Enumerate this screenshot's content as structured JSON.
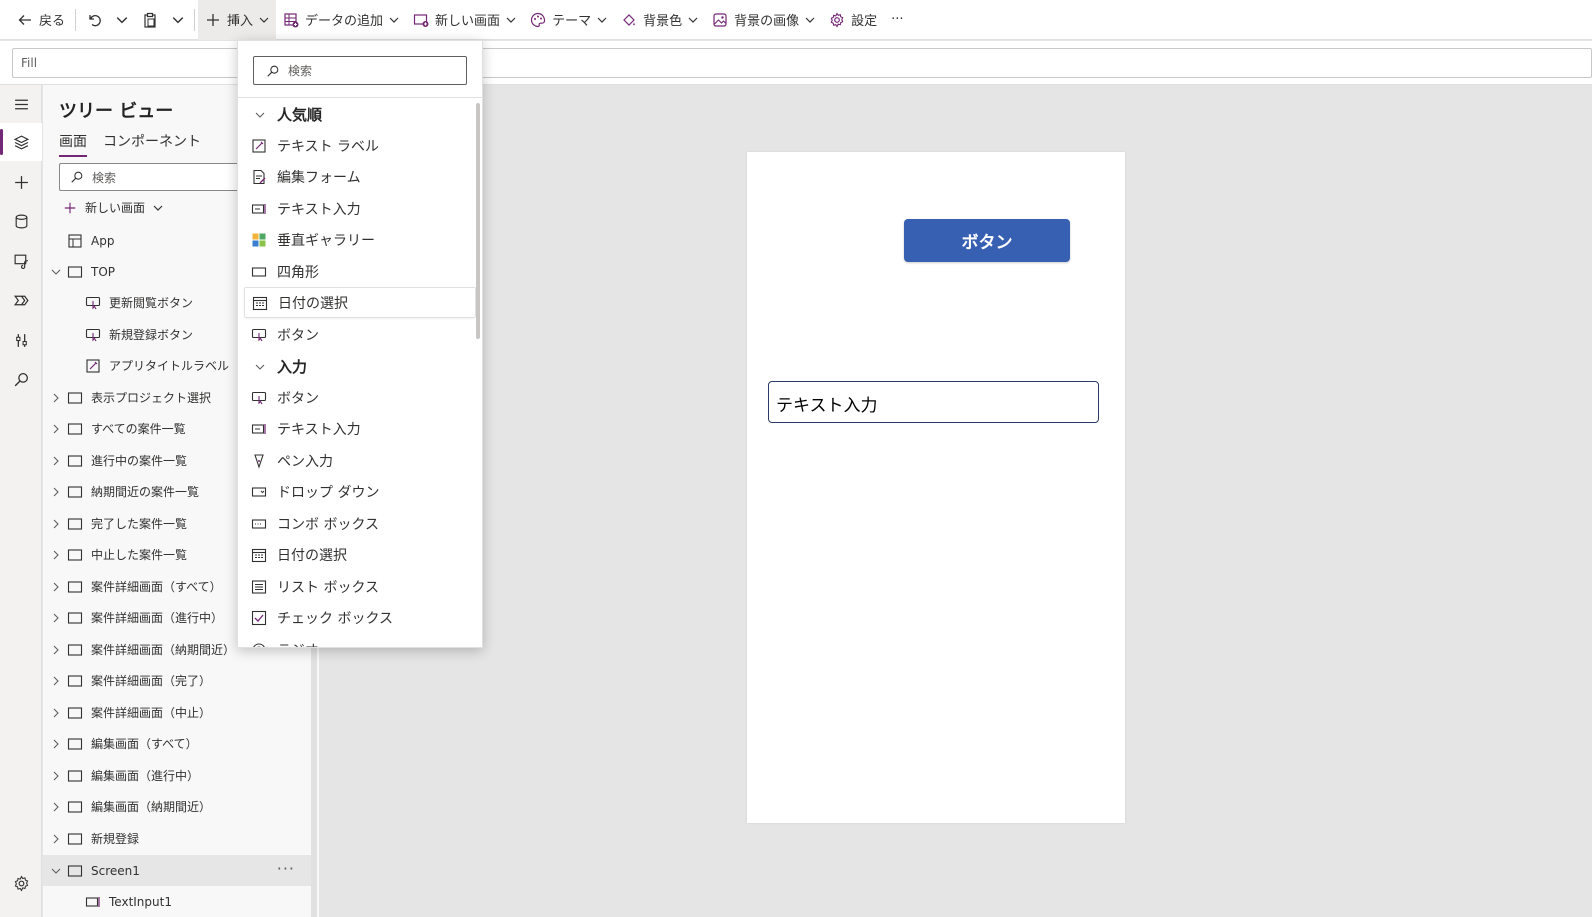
{
  "toolbar": {
    "back_label": "戻る",
    "insert_label": "挿入",
    "add_data_label": "データの追加",
    "new_screen_label": "新しい画面",
    "theme_label": "テーマ",
    "bg_color_label": "背景色",
    "bg_image_label": "背景の画像",
    "settings_label": "設定",
    "more_label": "···"
  },
  "formula": {
    "property": "Fill"
  },
  "tree": {
    "title": "ツリー ビュー",
    "tabs": [
      "画面",
      "コンポーネント"
    ],
    "search_placeholder": "検索",
    "new_screen_label": "新しい画面",
    "items": [
      {
        "label": "App"
      },
      {
        "label": "TOP"
      },
      {
        "label": "更新閲覧ボタン"
      },
      {
        "label": "新規登録ボタン"
      },
      {
        "label": "アプリタイトルラベル"
      },
      {
        "label": "表示プロジェクト選択"
      },
      {
        "label": "すべての案件一覧"
      },
      {
        "label": "進行中の案件一覧"
      },
      {
        "label": "納期間近の案件一覧"
      },
      {
        "label": "完了した案件一覧"
      },
      {
        "label": "中止した案件一覧"
      },
      {
        "label": "案件詳細画面（すべて）"
      },
      {
        "label": "案件詳細画面（進行中）"
      },
      {
        "label": "案件詳細画面（納期間近）"
      },
      {
        "label": "案件詳細画面（完了）"
      },
      {
        "label": "案件詳細画面（中止）"
      },
      {
        "label": "編集画面（すべて）"
      },
      {
        "label": "編集画面（進行中）"
      },
      {
        "label": "編集画面（納期間近）"
      },
      {
        "label": "新規登録"
      },
      {
        "label": "Screen1"
      },
      {
        "label": "TextInput1"
      }
    ],
    "more_label": "···"
  },
  "insert_panel": {
    "search_placeholder": "検索",
    "categories": [
      {
        "label": "人気順",
        "items": [
          "テキスト ラベル",
          "編集フォーム",
          "テキスト入力",
          "垂直ギャラリー",
          "四角形",
          "日付の選択",
          "ボタン"
        ]
      },
      {
        "label": "入力",
        "items": [
          "ボタン",
          "テキスト入力",
          "ペン入力",
          "ドロップ ダウン",
          "コンボ ボックス",
          "日付の選択",
          "リスト ボックス",
          "チェック ボックス",
          "ラジオ"
        ]
      }
    ]
  },
  "canvas": {
    "button_label": "ボタン",
    "text_input_value": "テキスト入力"
  },
  "colors": {
    "accent": "#742774",
    "button_fill": "#3860b2",
    "input_border": "#2b3a67"
  }
}
